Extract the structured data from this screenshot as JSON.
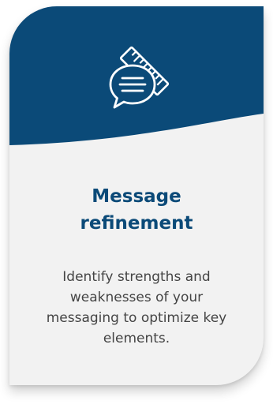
{
  "card": {
    "icon": "chat-ruler-icon",
    "title_line1": "Message",
    "title_line2": "refinement",
    "description": "Identify strengths and weaknesses of your messaging to optimize key elements."
  },
  "colors": {
    "header": "#0b4a78",
    "card_background": "#f2f2f2",
    "title": "#0b4a78",
    "description": "#444444"
  }
}
